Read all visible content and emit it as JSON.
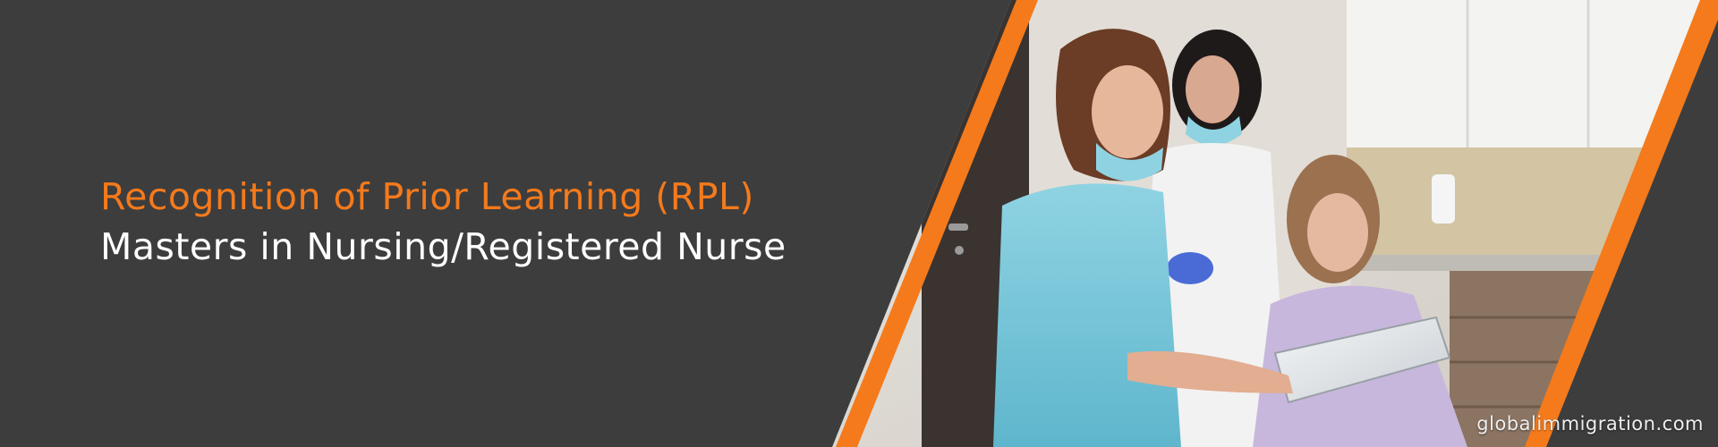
{
  "banner": {
    "title_line1": "Recognition of Prior Learning (RPL)",
    "title_line2": "Masters in Nursing/Registered Nurse",
    "website": "globalimmigration.com"
  },
  "colors": {
    "background": "#3d3d3d",
    "accent": "#f47a1c",
    "text_primary": "#ffffff"
  },
  "photo": {
    "subject": "two nurses in a dental clinic showing a tablet to a seated patient"
  }
}
